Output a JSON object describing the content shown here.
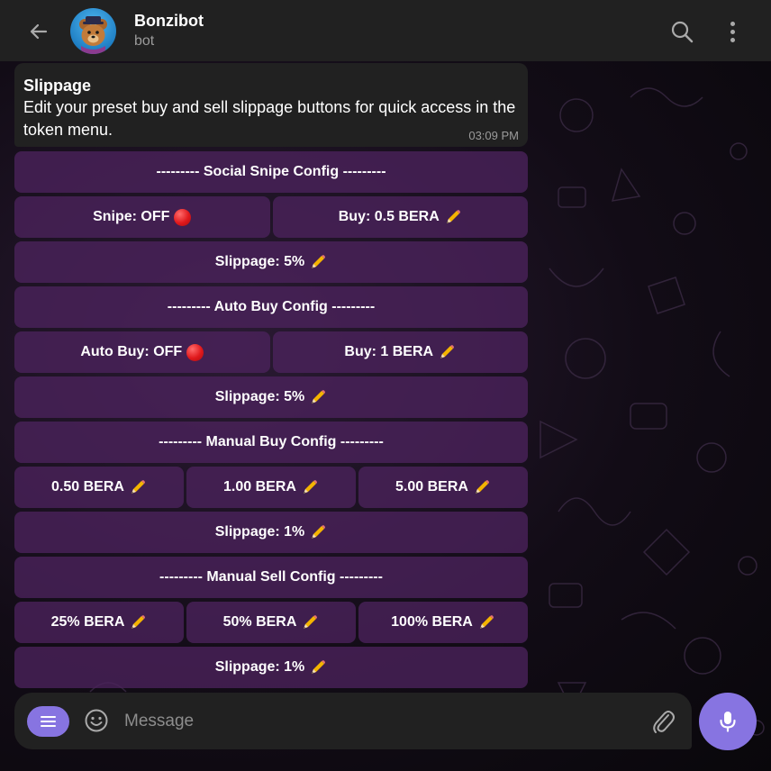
{
  "header": {
    "back_icon": "arrow-left-icon",
    "title": "Bonzibot",
    "subtitle": "bot",
    "search_icon": "search-icon",
    "more_icon": "more-vertical-icon"
  },
  "message": {
    "title": "Slippage",
    "text": "Edit your preset buy and sell slippage buttons for quick access in the token menu.",
    "time": "03:09 PM"
  },
  "keyboard": {
    "social_header": "--------- Social Snipe Config ---------",
    "social_snipe": "Snipe: OFF",
    "social_buy": "Buy: 0.5 BERA",
    "social_slippage": "Slippage: 5%",
    "auto_header": "--------- Auto Buy Config ---------",
    "auto_buy_toggle": "Auto Buy: OFF",
    "auto_buy_amount": "Buy: 1 BERA",
    "auto_slippage": "Slippage: 5%",
    "manual_buy_header": "--------- Manual Buy Config ---------",
    "manual_buy_1": "0.50 BERA",
    "manual_buy_2": "1.00 BERA",
    "manual_buy_3": "5.00 BERA",
    "manual_buy_slippage": "Slippage: 1%",
    "manual_sell_header": "--------- Manual Sell Config ---------",
    "manual_sell_1": "25% BERA",
    "manual_sell_2": "50% BERA",
    "manual_sell_3": "100% BERA",
    "manual_sell_slippage": "Slippage: 1%"
  },
  "composer": {
    "placeholder": "Message",
    "menu_icon": "menu-icon",
    "emoji_icon": "smiley-icon",
    "attach_icon": "paperclip-icon",
    "mic_icon": "microphone-icon"
  },
  "colors": {
    "accent": "#8774e1",
    "header_bg": "#212121",
    "keyboard_button": "#4c225c",
    "off_indicator": "#e0191c"
  }
}
